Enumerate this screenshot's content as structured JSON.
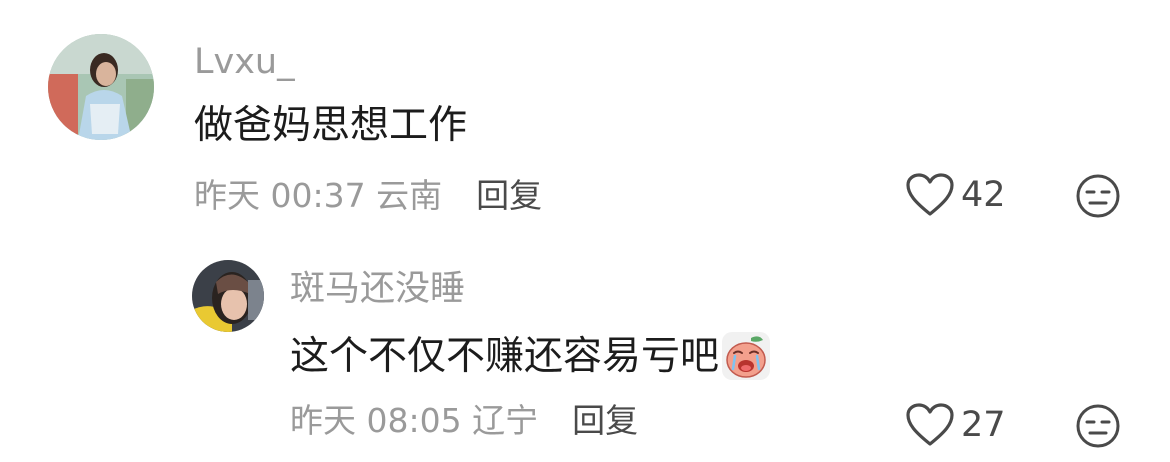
{
  "comments": [
    {
      "username": "Lvxu_",
      "text": "做爸妈思想工作",
      "time_location": "昨天 00:37 云南",
      "reply_label": "回复",
      "like_count": "42",
      "avatar_icon": "user-avatar",
      "like_icon": "heart-outline-icon",
      "dislike_icon": "neutral-face-icon"
    },
    {
      "username": "斑马还没睡",
      "text": "这个不仅不赚还容易亏吧",
      "sticker_icon": "crying-peach-sticker",
      "time_location": "昨天 08:05 辽宁",
      "reply_label": "回复",
      "like_count": "27",
      "avatar_icon": "user-avatar",
      "like_icon": "heart-outline-icon",
      "dislike_icon": "neutral-face-icon"
    }
  ],
  "colors": {
    "username": "#9a9a9a",
    "text": "#1c1c1c",
    "meta": "#9a9a9a",
    "action": "#4a4a4a"
  }
}
